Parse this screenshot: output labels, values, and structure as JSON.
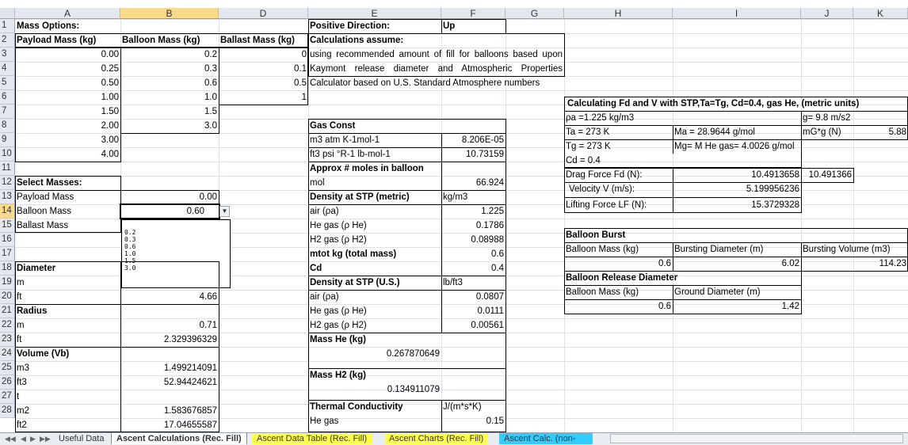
{
  "columns": [
    "A",
    "B",
    "D",
    "E",
    "F",
    "G",
    "H",
    "I",
    "J",
    "K"
  ],
  "rows": [
    "1",
    "2",
    "3",
    "4",
    "5",
    "6",
    "7",
    "8",
    "9",
    "10",
    "11",
    "12",
    "13",
    "14",
    "15",
    "16",
    "17",
    "18",
    "19",
    "20",
    "21",
    "22",
    "23",
    "24",
    "25",
    "26",
    "27",
    "28"
  ],
  "mass_options": {
    "title": "Mass Options:",
    "headers": [
      "Payload Mass (kg)",
      "Balloon Mass (kg)",
      "Ballast Mass (kg)"
    ],
    "payload": [
      "0.00",
      "0.25",
      "0.50",
      "1.00",
      "1.50",
      "2.00",
      "3.00",
      "4.00"
    ],
    "balloon": [
      "0.2",
      "0.3",
      "0.6",
      "1.0",
      "1.5",
      "3.0"
    ],
    "ballast": [
      "0",
      "0.1",
      "0.5",
      "1"
    ]
  },
  "positive_direction": {
    "label": "Positive Direction:",
    "value": "Up"
  },
  "calc_assume": {
    "title": "Calculations assume:",
    "lines": [
      "using recommended amount of fill for balloons based upon",
      "Kaymont release diameter and Atmospheric Properties",
      "Calculator based on U.S. Standard Atmosphere numbers"
    ]
  },
  "select_masses": {
    "title": "Select Masses:",
    "rows": [
      {
        "label": "Payload Mass",
        "value": "0.00"
      },
      {
        "label": "Balloon Mass",
        "value": "0.60"
      },
      {
        "label": "Ballast Mass",
        "value": ""
      }
    ],
    "dropdown_options": [
      "0.2",
      "0.3",
      "0.6",
      "1.0",
      "1.5",
      "3.0"
    ]
  },
  "diameter": {
    "title": "Diameter",
    "rows": [
      {
        "unit": "m",
        "value": ""
      },
      {
        "unit": "ft",
        "value": "4.66"
      }
    ]
  },
  "radius": {
    "title": "Radius",
    "rows": [
      {
        "unit": "m",
        "value": "0.71"
      },
      {
        "unit": "ft",
        "value": "2.329396329"
      }
    ]
  },
  "volume": {
    "title": "Volume (Vb)",
    "rows": [
      {
        "unit": "m3",
        "value": "1.499214091"
      },
      {
        "unit": "ft3",
        "value": "52.94424621"
      }
    ]
  },
  "surface": {
    "rows": [
      {
        "unit": "t",
        "value": ""
      },
      {
        "unit": "m2",
        "value": "1.583676857"
      },
      {
        "unit": "ft2",
        "value": "17.04655587"
      }
    ]
  },
  "gas_const": {
    "title": "Gas Const",
    "rows": [
      {
        "unit": "m3 atm K-1mol-1",
        "value": "8.206E-05"
      },
      {
        "unit": "ft3 psi °R-1 lb-mol-1",
        "value": "10.73159"
      }
    ]
  },
  "moles": {
    "title": "Approx # moles in balloon",
    "unit": "mol",
    "value": "66.924"
  },
  "density_metric": {
    "title": "Density at STP (metric)",
    "unit": "kg/m3",
    "rows": [
      {
        "label": "air (ρa)",
        "value": "1.225"
      },
      {
        "label": "He gas (ρ He)",
        "value": "0.1786"
      },
      {
        "label": "H2 gas (ρ H2)",
        "value": "0.08988"
      }
    ]
  },
  "mtot": {
    "label": "mtot kg (total mass)",
    "value": "0.6"
  },
  "cd": {
    "label": "Cd",
    "value": "0.4"
  },
  "density_us": {
    "title": "Density at STP (U.S.)",
    "unit": "lb/ft3",
    "rows": [
      {
        "label": "air (ρa)",
        "value": "0.0807"
      },
      {
        "label": "He gas (ρ He)",
        "value": "0.0111"
      },
      {
        "label": "H2 gas (ρ H2)",
        "value": "0.00561"
      }
    ]
  },
  "mass_he": {
    "title": "Mass He (kg)",
    "value": "0.267870649"
  },
  "mass_h2": {
    "title": "Mass H2 (kg)",
    "value": "0.134911079"
  },
  "thermal": {
    "title": "Thermal Conductivity",
    "unit": "J/(m*s*K)",
    "row_label": "He gas",
    "row_value": "0.15"
  },
  "fd_calc": {
    "title": "Calculating Fd and V with STP,Ta=Tg, Cd=0.4, gas He, (metric units)",
    "rho_a": "ρa =1.225 kg/m3",
    "g": "g= 9.8 m/s2",
    "ta": "Ta = 273 K",
    "ma": "Ma = 28.9644 g/mol",
    "mg_label": "mG*g (N)",
    "mg_value": "5.88",
    "tg": "Tg = 273 K",
    "mg_he": "Mg= M He gas= 4.0026 g/mol",
    "cd": "Cd = 0.4",
    "drag_label": "Drag Force Fd (N):",
    "drag_value": "10.4913658",
    "drag_value2": "10.491366",
    "vel_label": "Velocity V (m/s):",
    "vel_value": "5.199956236",
    "lift_label": "Lifting Force LF (N):",
    "lift_value": "15.3729328"
  },
  "burst": {
    "title": "Balloon Burst",
    "headers": [
      "Balloon Mass (kg)",
      "Bursting Diameter (m)",
      "Bursting Volume (m3)"
    ],
    "values": [
      "0.6",
      "6.02",
      "114.23"
    ]
  },
  "release": {
    "title": "Balloon Release Diameter",
    "headers": [
      "Balloon Mass (kg)",
      "Ground Diameter (m)"
    ],
    "values": [
      "0.6",
      "1.42"
    ]
  },
  "sheet_tabs": [
    "Useful Data",
    "Ascent Calculations (Rec. Fill)",
    "Ascent Data Table (Rec. Fill)",
    "Ascent Charts (Rec. Fill)",
    "Ascent Calc. (non-"
  ],
  "colors": {
    "tab_yellow": "#ffff4d",
    "tab_cyan": "#33ccff",
    "selected_header": "#f9d98a"
  }
}
